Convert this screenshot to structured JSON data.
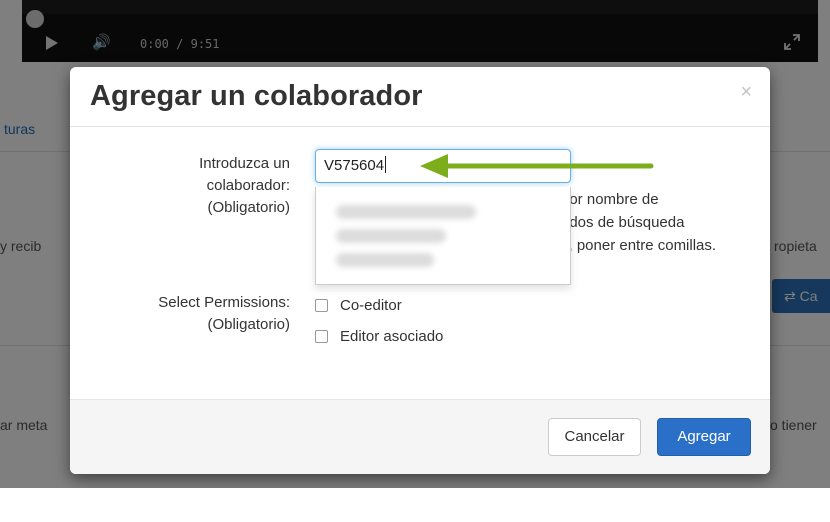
{
  "video": {
    "current_time": "0:00",
    "duration": "/ 9:51"
  },
  "background": {
    "tab_text": "turas",
    "left_text_1": "y recib",
    "left_text_2": "ar meta",
    "right_text_1": "ropieta",
    "right_text_2": "o tiener",
    "right_button_label": "⇄ Ca"
  },
  "modal": {
    "title": "Agregar un colaborador",
    "close_label": "×",
    "collaborator": {
      "label_line1": "Introduzca un",
      "label_line2": "colaborador:",
      "label_line3": "(Obligatorio)",
      "value": "V575604",
      "help_line1": "por nombre de",
      "help_line2": "ados de búsqueda",
      "help_line3": "s, poner entre comillas."
    },
    "permissions": {
      "label_line1": "Select Permissions:",
      "label_line2": "(Obligatorio)",
      "options": [
        {
          "label": "Co-editor",
          "checked": false
        },
        {
          "label": "Editor asociado",
          "checked": false
        }
      ]
    },
    "footer": {
      "cancel_label": "Cancelar",
      "add_label": "Agregar"
    }
  },
  "colors": {
    "primary_button": "#2a70c8",
    "annotation_arrow": "#7cae1c",
    "input_focus": "#66afe9"
  }
}
